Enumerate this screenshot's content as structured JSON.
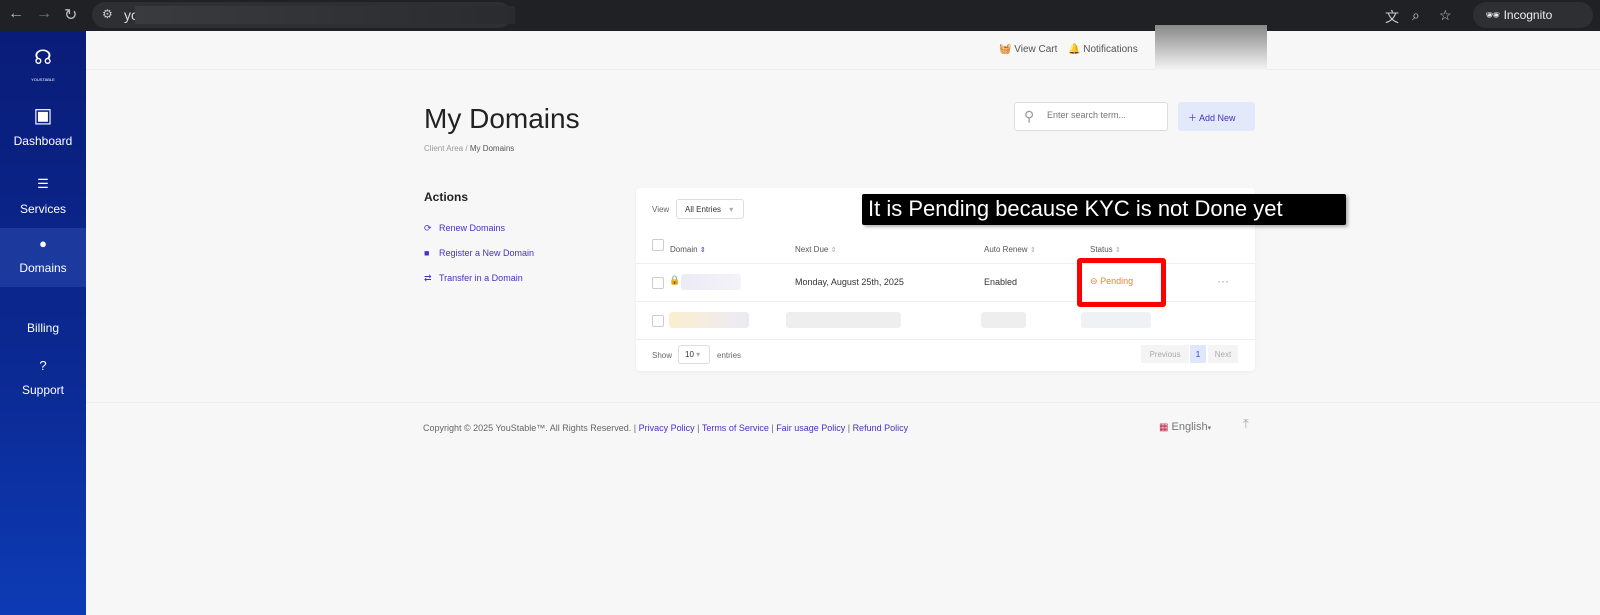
{
  "browser": {
    "url_prefix": "yo",
    "incognito_label": "Incognito"
  },
  "sidebar": {
    "brand": "YOUSTABLE",
    "items": [
      {
        "label": "Dashboard"
      },
      {
        "label": "Services"
      },
      {
        "label": "Domains"
      },
      {
        "label": "Billing"
      },
      {
        "label": "Support"
      }
    ]
  },
  "header": {
    "view_cart": "View Cart",
    "notifications": "Notifications"
  },
  "page": {
    "title": "My Domains",
    "breadcrumb": [
      "Client Area",
      "My Domains"
    ],
    "search_placeholder": "Enter search term...",
    "add_new": "Add New"
  },
  "actions": {
    "title": "Actions",
    "items": [
      "Renew Domains",
      "Register a New Domain",
      "Transfer in a Domain"
    ]
  },
  "table": {
    "view_label": "View",
    "view_value": "All Entries",
    "columns": [
      "Domain",
      "Next Due",
      "Auto Renew",
      "Status"
    ],
    "rows": [
      {
        "next_due": "Monday, August 25th, 2025",
        "auto_renew": "Enabled",
        "status": "Pending"
      }
    ],
    "show_label": "Show",
    "show_value": "10",
    "entries_label": "entries",
    "pager": {
      "previous": "Previous",
      "page": "1",
      "next": "Next"
    }
  },
  "annotation": "It is Pending because KYC is not Done yet",
  "footer": {
    "copyright": "Copyright © 2025 YouStable™. All Rights Reserved. |",
    "links": [
      "Privacy Policy",
      "Terms of Service",
      "Fair usage Policy",
      "Refund Policy"
    ],
    "language": "English"
  },
  "colors": {
    "accent": "#4a2fc4",
    "pending": "#e08a1e",
    "sidebar": "#0a1c78",
    "highlight": "#ff0000"
  }
}
